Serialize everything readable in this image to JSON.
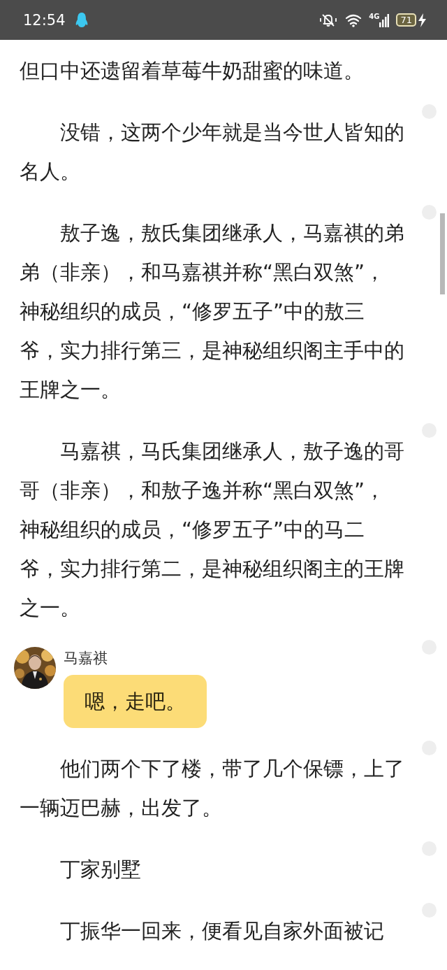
{
  "status_bar": {
    "time": "12:54",
    "network": "4G",
    "battery": "71"
  },
  "blocks": [
    {
      "kind": "paragraph",
      "indent": false,
      "text": "但口中还遗留着草莓牛奶甜蜜的味道。"
    },
    {
      "kind": "paragraph",
      "indent": true,
      "text": "没错，这两个少年就是当今世人皆知的名人。"
    },
    {
      "kind": "paragraph",
      "indent": true,
      "text": "敖子逸，敖氏集团继承人，马嘉祺的弟弟（非亲），和马嘉祺并称“黑白双煞”，神秘组织的成员，“修罗五子”中的敖三爷，实力排行第三，是神秘组织阁主手中的王牌之一。"
    },
    {
      "kind": "paragraph",
      "indent": true,
      "text": "马嘉祺，马氏集团继承人，敖子逸的哥哥（非亲），和敖子逸并称“黑白双煞”，神秘组织的成员，“修罗五子”中的马二爷，实力排行第二，是神秘组织阁主的王牌之一。"
    },
    {
      "kind": "chat",
      "name": "马嘉祺",
      "message": "嗯，走吧。"
    },
    {
      "kind": "paragraph",
      "indent": true,
      "text": "他们两个下了楼，带了几个保镖，上了一辆迈巴赫，出发了。"
    },
    {
      "kind": "paragraph",
      "indent": true,
      "text": "丁家别墅"
    },
    {
      "kind": "paragraph",
      "indent": true,
      "text": "丁振华一回来，便看见自家外面被记"
    }
  ]
}
